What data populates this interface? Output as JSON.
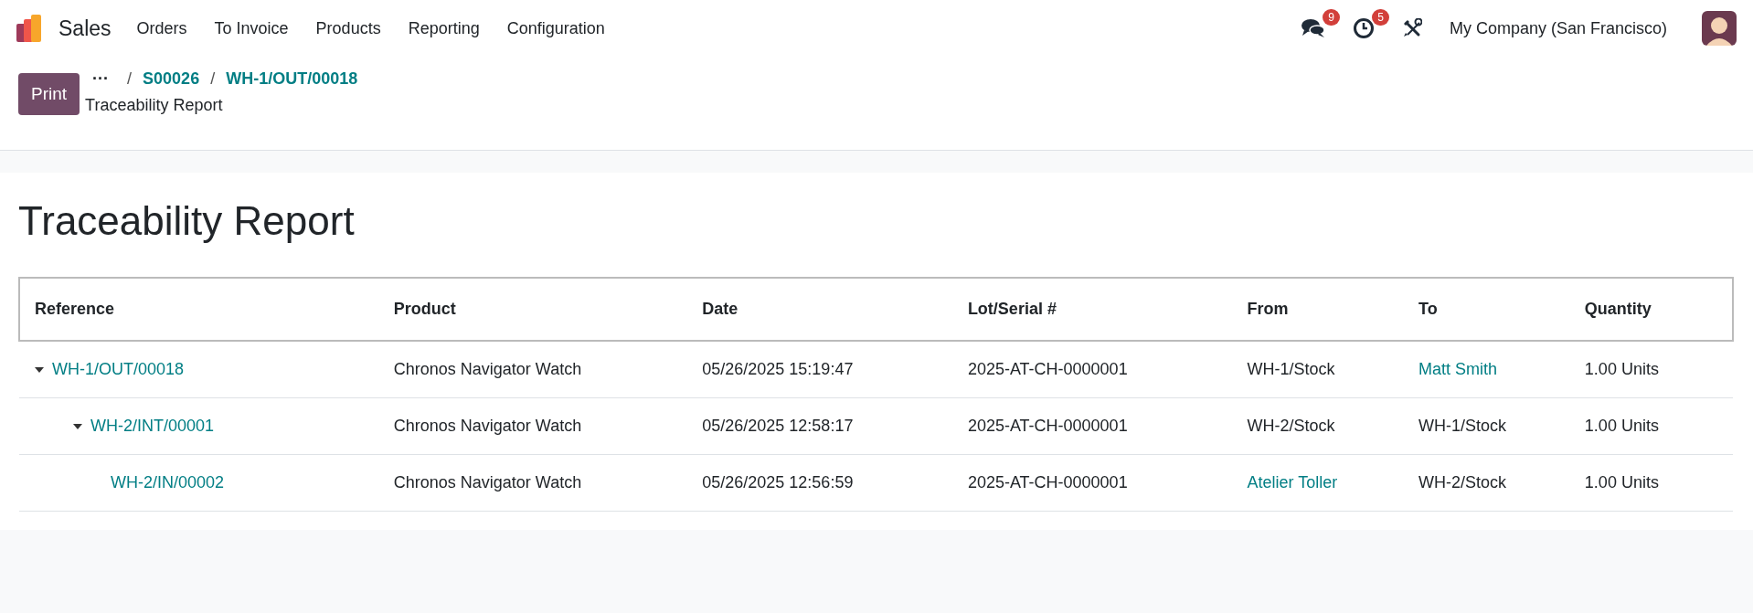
{
  "navbar": {
    "app": "Sales",
    "menu": [
      "Orders",
      "To Invoice",
      "Products",
      "Reporting",
      "Configuration"
    ],
    "messages_count": "9",
    "activities_count": "5",
    "company": "My Company (San Francisco)"
  },
  "control_panel": {
    "print": "Print",
    "more": "···",
    "separator": "/",
    "breadcrumbs": [
      "S00026",
      "WH-1/OUT/00018"
    ],
    "current": "Traceability Report"
  },
  "report": {
    "title": "Traceability Report",
    "columns": [
      "Reference",
      "Product",
      "Date",
      "Lot/Serial #",
      "From",
      "To",
      "Quantity"
    ],
    "rows": [
      {
        "reference": "WH-1/OUT/00018",
        "expanded": true,
        "product": "Chronos Navigator Watch",
        "date": "05/26/2025 15:19:47",
        "lot": "2025-AT-CH-0000001",
        "from": {
          "text": "WH-1/Stock",
          "link": false
        },
        "to": {
          "text": "Matt Smith",
          "link": true
        },
        "quantity": "1.00 Units",
        "children": [
          {
            "reference": "WH-2/INT/00001",
            "expanded": true,
            "product": "Chronos Navigator Watch",
            "date": "05/26/2025 12:58:17",
            "lot": "2025-AT-CH-0000001",
            "from": {
              "text": "WH-2/Stock",
              "link": false
            },
            "to": {
              "text": "WH-1/Stock",
              "link": false
            },
            "quantity": "1.00 Units",
            "children": [
              {
                "reference": "WH-2/IN/00002",
                "product": "Chronos Navigator Watch",
                "date": "05/26/2025 12:56:59",
                "lot": "2025-AT-CH-0000001",
                "from": {
                  "text": "Atelier Toller",
                  "link": true
                },
                "to": {
                  "text": "WH-2/Stock",
                  "link": false
                },
                "quantity": "1.00 Units"
              }
            ]
          }
        ]
      }
    ]
  }
}
